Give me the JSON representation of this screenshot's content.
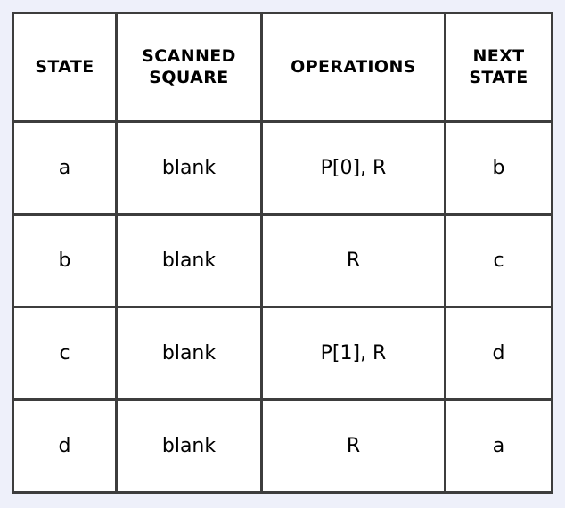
{
  "page": {
    "background_color": "#eef0fa",
    "border_color": "#3d3d3d",
    "cell_background_color": "#ffffff",
    "text_color": "#000000"
  },
  "table": {
    "headers": [
      {
        "id": "state",
        "label": "STATE",
        "lines": [
          "STATE"
        ]
      },
      {
        "id": "scanned-square",
        "label": "SCANNED SQUARE",
        "lines": [
          "SCANNED",
          "SQUARE"
        ]
      },
      {
        "id": "operations",
        "label": "OPERATIONS",
        "lines": [
          "OPERATIONS"
        ]
      },
      {
        "id": "next-state",
        "label": "NEXT STATE",
        "lines": [
          "NEXT",
          "STATE"
        ]
      }
    ],
    "rows": [
      {
        "state": "a",
        "scanned_square": "blank",
        "operations": "P[0], R",
        "next_state": "b"
      },
      {
        "state": "b",
        "scanned_square": "blank",
        "operations": "R",
        "next_state": "c"
      },
      {
        "state": "c",
        "scanned_square": "blank",
        "operations": "P[1], R",
        "next_state": "d"
      },
      {
        "state": "d",
        "scanned_square": "blank",
        "operations": "R",
        "next_state": "a"
      }
    ]
  }
}
